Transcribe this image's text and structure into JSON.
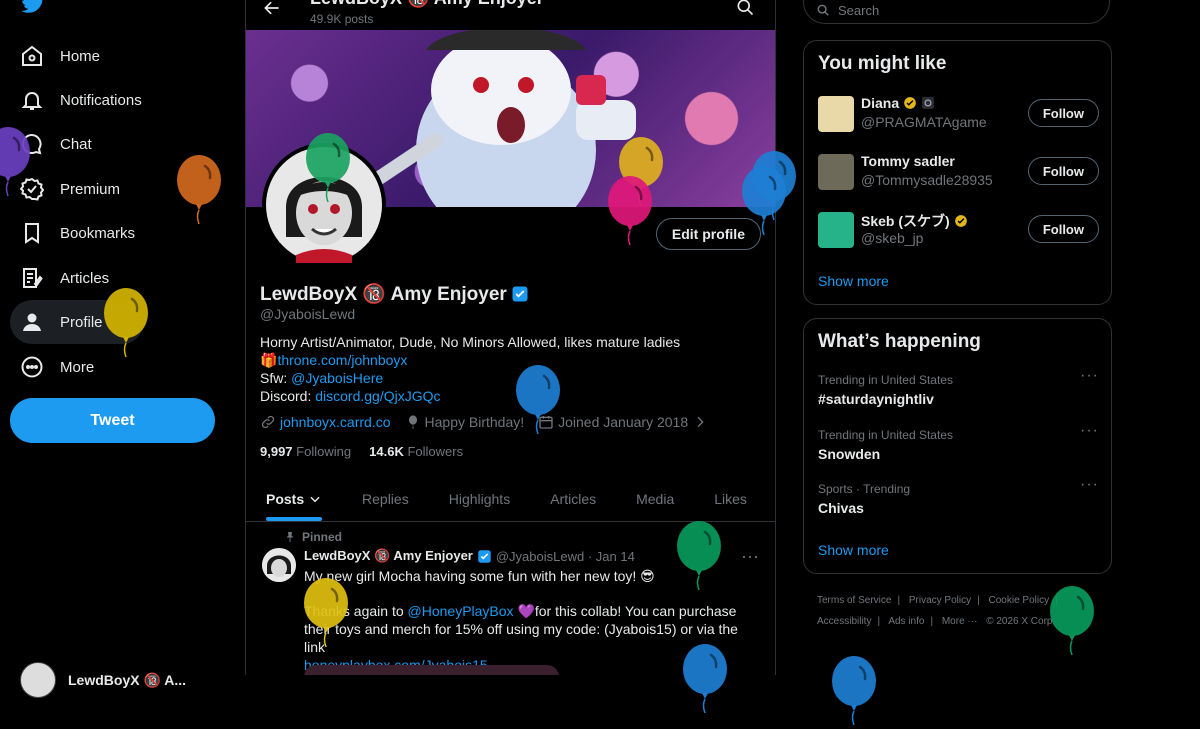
{
  "nav": {
    "items": [
      {
        "label": "Home",
        "icon": "home-icon"
      },
      {
        "label": "Notifications",
        "icon": "bell-icon"
      },
      {
        "label": "Chat",
        "icon": "chat-icon"
      },
      {
        "label": "Premium",
        "icon": "premium-icon"
      },
      {
        "label": "Bookmarks",
        "icon": "bookmark-icon"
      },
      {
        "label": "Articles",
        "icon": "articles-icon"
      },
      {
        "label": "Profile",
        "icon": "profile-icon"
      },
      {
        "label": "More",
        "icon": "more-icon"
      }
    ],
    "tweet_button": "Tweet",
    "account_name": "LewdBoyX 🔞 A..."
  },
  "header": {
    "name": "LewdBoyX 🔞 Amy Enjoyer",
    "posts": "49.9K posts"
  },
  "profile": {
    "edit_button": "Edit profile",
    "display_name": "LewdBoyX 🔞 Amy Enjoyer",
    "handle": "@JyaboisLewd",
    "bio_line1": "Horny Artist/Animator, Dude, No Minors Allowed, likes mature ladies",
    "bio_gift": "🎁",
    "bio_link1": "throne.com/johnboyx",
    "bio_sfw_label": "Sfw: ",
    "bio_sfw_link": "@JyaboisHere",
    "bio_discord_label": "Discord: ",
    "bio_discord_link": "discord.gg/QjxJGQc",
    "website": "johnboyx.carrd.co",
    "birthday": "Happy Birthday!",
    "joined": "Joined January 2018",
    "following_count": "9,997",
    "following_label": "Following",
    "followers_count": "14.6K",
    "followers_label": "Followers"
  },
  "tabs": [
    "Posts",
    "Replies",
    "Highlights",
    "Articles",
    "Media",
    "Likes"
  ],
  "post": {
    "pinned_label": "Pinned",
    "author": "LewdBoyX 🔞 Amy Enjoyer",
    "handle_time": "@JyaboisLewd · Jan 14",
    "line1": "My new girl Mocha having some fun with her new toy! 😎",
    "line2_a": "Thanks again to ",
    "line2_mention": "@HoneyPlayBox",
    "line2_b": " 💜for this collab! You can purchase their toys and merch for 15% off using my code: (Jyabois15) or via the link",
    "link": "honeyplaybox.com/Jyabois15"
  },
  "right": {
    "search_placeholder": "Search",
    "wtf_title": "You might like",
    "wtf": [
      {
        "name": "Diana",
        "handle": "@PRAGMATAgame",
        "button": "Follow",
        "avatar_color": "#e9d9a8"
      },
      {
        "name": "Tommy sadler",
        "handle": "@Tommysadle28935",
        "button": "Follow",
        "avatar_color": "#6d6a5a"
      },
      {
        "name": "Skeb (スケブ)",
        "handle": "@skeb_jp",
        "button": "Follow",
        "avatar_color": "#27b389"
      }
    ],
    "wtf_show_more": "Show more",
    "happening_title": "What’s happening",
    "trends": [
      {
        "context": "Trending in United States",
        "title": "#saturdaynightliv"
      },
      {
        "context": "Trending in United States",
        "title": "Snowden"
      },
      {
        "context": "Sports · Trending",
        "title": "Chivas"
      }
    ],
    "happening_show_more": "Show more",
    "footer": [
      "Terms of Service",
      "|",
      "Privacy Policy",
      "|",
      "Cookie Policy",
      "|",
      "Accessibility",
      "|",
      "Ads info",
      "|",
      "More ···",
      "© 2026 X Corp."
    ]
  },
  "colors": {
    "accent": "#1d9bf0",
    "background": "#000000",
    "border": "#2f3336",
    "muted": "#71767b"
  },
  "balloons": [
    {
      "color": "#6a3fc0"
    },
    {
      "color": "#d2691e"
    },
    {
      "color": "#d4b400"
    },
    {
      "color": "#1aa260"
    },
    {
      "color": "#e0b020"
    },
    {
      "color": "#e0187a"
    },
    {
      "color": "#1d7fd4"
    },
    {
      "color": "#1d7fd4"
    },
    {
      "color": "#1d7fd4"
    },
    {
      "color": "#089a5c"
    },
    {
      "color": "#e0c010"
    },
    {
      "color": "#089a5c"
    },
    {
      "color": "#1d7fd4"
    },
    {
      "color": "#1d7fd4"
    }
  ]
}
